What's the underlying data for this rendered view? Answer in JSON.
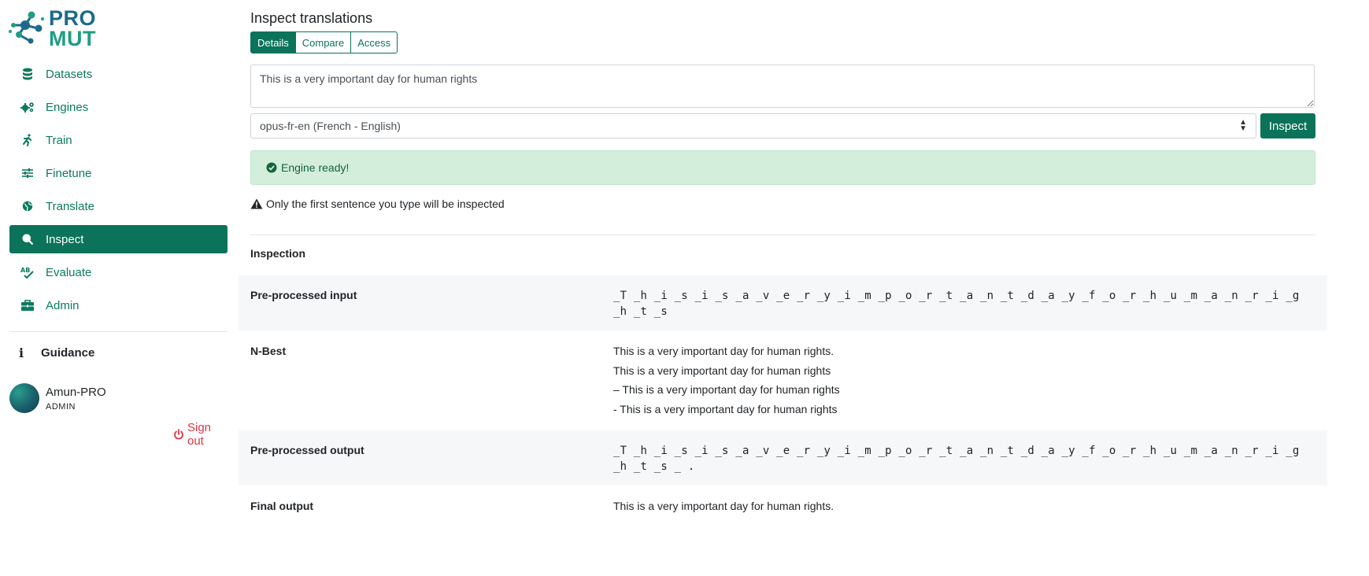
{
  "brand": {
    "line1": "PRO",
    "line2": "MUT"
  },
  "sidebar": {
    "items": [
      {
        "label": "Datasets",
        "icon": "database-icon"
      },
      {
        "label": "Engines",
        "icon": "gears-icon"
      },
      {
        "label": "Train",
        "icon": "running-icon"
      },
      {
        "label": "Finetune",
        "icon": "sliders-icon"
      },
      {
        "label": "Translate",
        "icon": "globe-icon"
      },
      {
        "label": "Inspect",
        "icon": "search-icon",
        "active": true
      },
      {
        "label": "Evaluate",
        "icon": "spellcheck-icon"
      },
      {
        "label": "Admin",
        "icon": "toolbox-icon"
      }
    ],
    "guidance": "Guidance",
    "user": {
      "name": "Amun-PRO",
      "role": "ADMIN"
    },
    "signout": "Sign out"
  },
  "main": {
    "title": "Inspect translations",
    "tabs": [
      {
        "label": "Details",
        "active": true
      },
      {
        "label": "Compare"
      },
      {
        "label": "Access"
      }
    ],
    "input_text": "This is a very important day for human rights",
    "engine_selected": "opus-fr-en (French - English)",
    "inspect_button": "Inspect",
    "alert": "Engine ready!",
    "warning": "Only the first sentence you type will be inspected",
    "section_title": "Inspection",
    "rows": {
      "preprocessed_input": {
        "label": "Pre-processed input",
        "value": "_T _h _i _s _i _s _a _v _e _r _y _i _m _p _o _r _t _a _n _t _d _a _y _f _o _r _h _u _m _a _n _r _i _g _h _t _s"
      },
      "nbest": {
        "label": "N-Best",
        "values": [
          "This is a very important day for human rights.",
          "This is a very important day for human rights",
          "– This is a very important day for human rights",
          "- This is a very important day for human rights"
        ]
      },
      "preprocessed_output": {
        "label": "Pre-processed output",
        "value": "_T _h _i _s _i _s _a _v _e _r _y _i _m _p _o _r _t _a _n _t _d _a _y _f _o _r _h _u _m _a _n _r _i _g _h _t _s _ ."
      },
      "final_output": {
        "label": "Final output",
        "value": "This is a very important day for human rights."
      }
    }
  },
  "colors": {
    "primary": "#0b7359",
    "success_bg": "#d3eedb",
    "danger": "#dc3545"
  }
}
